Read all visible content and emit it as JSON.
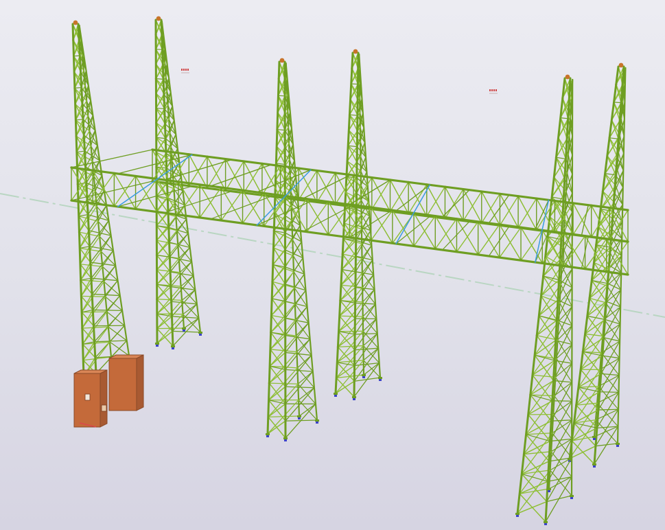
{
  "viewport": {
    "background_top": "#ececf2",
    "background_bottom": "#d6d4e2"
  },
  "colors": {
    "steel_member": "#6e9e22",
    "steel_member_light": "#8fbf36",
    "bracing_blue": "#3a9be0",
    "connection_node": "#c8742a",
    "base_plate": "#3b43c8",
    "foundation_block": "#c46a3a",
    "grid_line": "#b9d6c2"
  },
  "model": {
    "towers": 6,
    "beam_spans": 2
  }
}
